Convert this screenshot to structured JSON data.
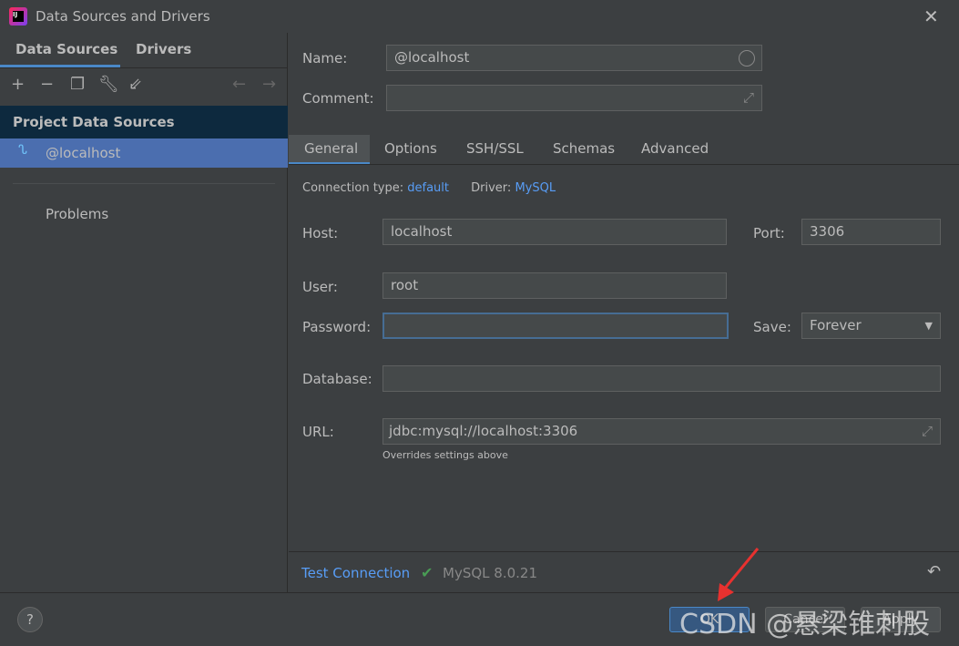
{
  "window": {
    "title": "Data Sources and Drivers"
  },
  "left": {
    "tabs": [
      "Data Sources",
      "Drivers"
    ],
    "section": "Project Data Sources",
    "items": [
      {
        "label": "@localhost",
        "selected": true
      }
    ],
    "problems": "Problems"
  },
  "form": {
    "name_label": "Name:",
    "name_value": "@localhost",
    "comment_label": "Comment:",
    "comment_value": "",
    "tabs": [
      "General",
      "Options",
      "SSH/SSL",
      "Schemas",
      "Advanced"
    ],
    "active_tab": "General",
    "connection_type_label": "Connection type:",
    "connection_type": "default",
    "driver_label": "Driver:",
    "driver": "MySQL",
    "host_label": "Host:",
    "host": "localhost",
    "port_label": "Port:",
    "port": "3306",
    "user_label": "User:",
    "user": "root",
    "password_label": "Password:",
    "password": "",
    "save_label": "Save:",
    "save_value": "Forever",
    "database_label": "Database:",
    "database": "",
    "url_label": "URL:",
    "url": "jdbc:mysql://localhost:3306",
    "url_hint": "Overrides settings above"
  },
  "status": {
    "test_connection": "Test Connection",
    "result": "MySQL 8.0.21"
  },
  "footer": {
    "help": "?",
    "ok": "OK",
    "cancel": "Cancel",
    "apply": "Apply"
  },
  "watermark": "CSDN @悬梁锥刺股",
  "colors": {
    "accent": "#4a88c7",
    "selection": "#4b6eaf",
    "link": "#589df6",
    "check": "#499c54",
    "arrow": "#e8312f"
  }
}
